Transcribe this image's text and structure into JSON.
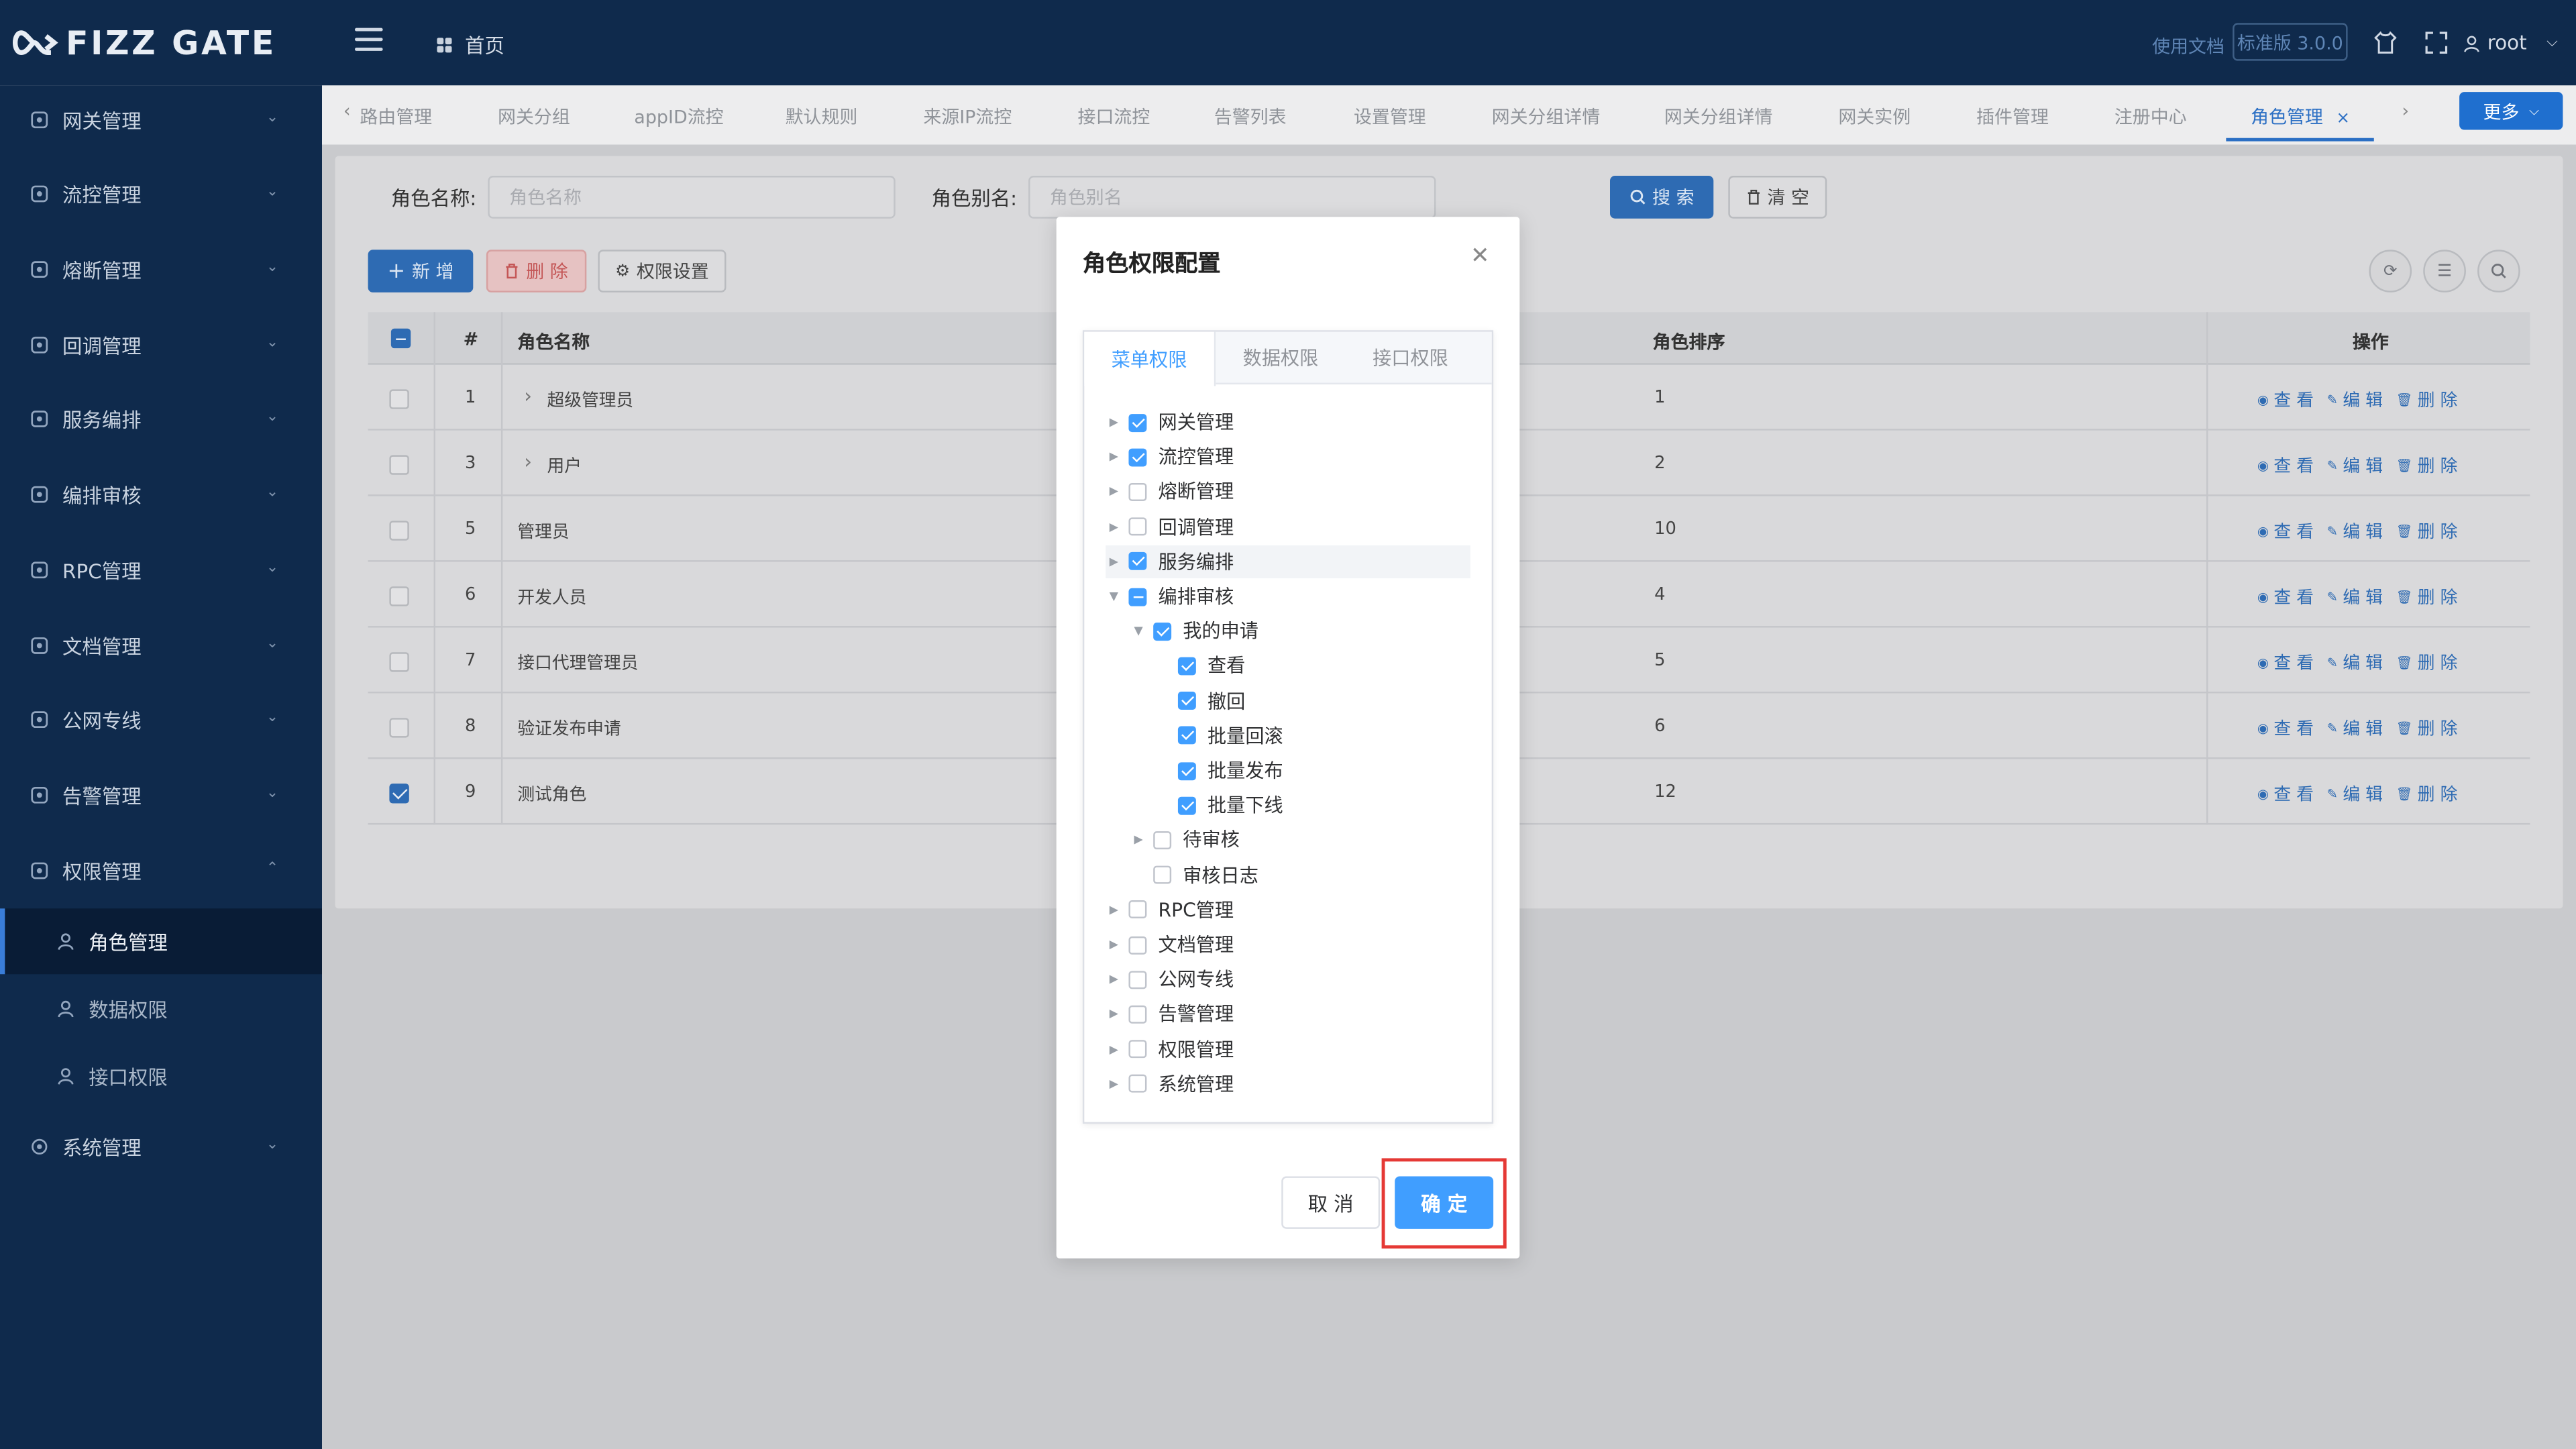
{
  "header": {
    "logo_text": "FIZZ GATE",
    "home": "首页",
    "doc_link": "使用文档",
    "version": "标准版 3.0.0",
    "user": "root"
  },
  "sidebar": {
    "items": [
      {
        "label": "网关管理",
        "icon": "gateway-icon"
      },
      {
        "label": "流控管理",
        "icon": "flow-icon"
      },
      {
        "label": "熔断管理",
        "icon": "circuit-icon"
      },
      {
        "label": "回调管理",
        "icon": "callback-icon"
      },
      {
        "label": "服务编排",
        "icon": "orchestrate-icon"
      },
      {
        "label": "编排审核",
        "icon": "review-icon"
      },
      {
        "label": "RPC管理",
        "icon": "rpc-icon"
      },
      {
        "label": "文档管理",
        "icon": "doc-icon"
      },
      {
        "label": "公网专线",
        "icon": "network-icon"
      },
      {
        "label": "告警管理",
        "icon": "bell-icon"
      },
      {
        "label": "权限管理",
        "icon": "lock-icon"
      }
    ],
    "sub_items": [
      {
        "label": "角色管理",
        "icon": "user-icon"
      },
      {
        "label": "数据权限",
        "icon": "bar-chart-icon"
      },
      {
        "label": "接口权限",
        "icon": "bolt-icon"
      }
    ],
    "last_item": {
      "label": "系统管理",
      "icon": "gear-icon"
    }
  },
  "tabs": {
    "items": [
      "路由管理",
      "网关分组",
      "appID流控",
      "默认规则",
      "来源IP流控",
      "接口流控",
      "告警列表",
      "设置管理",
      "网关分组详情",
      "网关分组详情",
      "网关实例",
      "插件管理",
      "注册中心",
      "角色管理"
    ],
    "more": "更多"
  },
  "filters": {
    "role_name_label": "角色名称:",
    "role_name_placeholder": "角色名称",
    "role_alias_label": "角色别名:",
    "role_alias_placeholder": "角色别名",
    "search": "搜 索",
    "clear": "清 空"
  },
  "toolbar": {
    "add": "新 增",
    "delete": "删 除",
    "permission": "权限设置"
  },
  "table": {
    "columns": {
      "index": "#",
      "name": "角色名称",
      "order": "角色排序",
      "ops": "操作"
    },
    "ops": {
      "view": "查 看",
      "edit": "编 辑",
      "delete": "删 除"
    },
    "rows": [
      {
        "id": "1",
        "name": "超级管理员",
        "order": "1",
        "checked": false,
        "expandable": true
      },
      {
        "id": "3",
        "name": "用户",
        "order": "2",
        "checked": false,
        "expandable": true
      },
      {
        "id": "5",
        "name": "管理员",
        "order": "10",
        "checked": false,
        "expandable": false
      },
      {
        "id": "6",
        "name": "开发人员",
        "order": "4",
        "checked": false,
        "expandable": false
      },
      {
        "id": "7",
        "name": "接口代理管理员",
        "order": "5",
        "checked": false,
        "expandable": false
      },
      {
        "id": "8",
        "name": "验证发布申请",
        "order": "6",
        "checked": false,
        "expandable": false
      },
      {
        "id": "9",
        "name": "测试角色",
        "order": "12",
        "checked": true,
        "expandable": false
      }
    ]
  },
  "modal": {
    "title": "角色权限配置",
    "tabs": [
      "菜单权限",
      "数据权限",
      "接口权限"
    ],
    "tree": [
      {
        "label": "网关管理",
        "state": "checked",
        "depth": 0,
        "arrow": "right"
      },
      {
        "label": "流控管理",
        "state": "checked",
        "depth": 0,
        "arrow": "right"
      },
      {
        "label": "熔断管理",
        "state": "none",
        "depth": 0,
        "arrow": "right"
      },
      {
        "label": "回调管理",
        "state": "none",
        "depth": 0,
        "arrow": "right"
      },
      {
        "label": "服务编排",
        "state": "checked",
        "depth": 0,
        "arrow": "right"
      },
      {
        "label": "编排审核",
        "state": "partial",
        "depth": 0,
        "arrow": "down"
      },
      {
        "label": "我的申请",
        "state": "checked",
        "depth": 1,
        "arrow": "down"
      },
      {
        "label": "查看",
        "state": "checked",
        "depth": 2,
        "arrow": "none"
      },
      {
        "label": "撤回",
        "state": "checked",
        "depth": 2,
        "arrow": "none"
      },
      {
        "label": "批量回滚",
        "state": "checked",
        "depth": 2,
        "arrow": "none"
      },
      {
        "label": "批量发布",
        "state": "checked",
        "depth": 2,
        "arrow": "none"
      },
      {
        "label": "批量下线",
        "state": "checked",
        "depth": 2,
        "arrow": "none"
      },
      {
        "label": "待审核",
        "state": "none",
        "depth": 1,
        "arrow": "right"
      },
      {
        "label": "审核日志",
        "state": "none",
        "depth": 1,
        "arrow": "none"
      },
      {
        "label": "RPC管理",
        "state": "none",
        "depth": 0,
        "arrow": "right"
      },
      {
        "label": "文档管理",
        "state": "none",
        "depth": 0,
        "arrow": "right"
      },
      {
        "label": "公网专线",
        "state": "none",
        "depth": 0,
        "arrow": "right"
      },
      {
        "label": "告警管理",
        "state": "none",
        "depth": 0,
        "arrow": "right"
      },
      {
        "label": "权限管理",
        "state": "none",
        "depth": 0,
        "arrow": "right"
      },
      {
        "label": "系统管理",
        "state": "none",
        "depth": 0,
        "arrow": "right"
      }
    ],
    "cancel": "取 消",
    "confirm": "确 定"
  },
  "colors": {
    "sidebar_bg": "#0f2a4c",
    "accent": "#409eff",
    "highlight_border": "#e53935"
  }
}
